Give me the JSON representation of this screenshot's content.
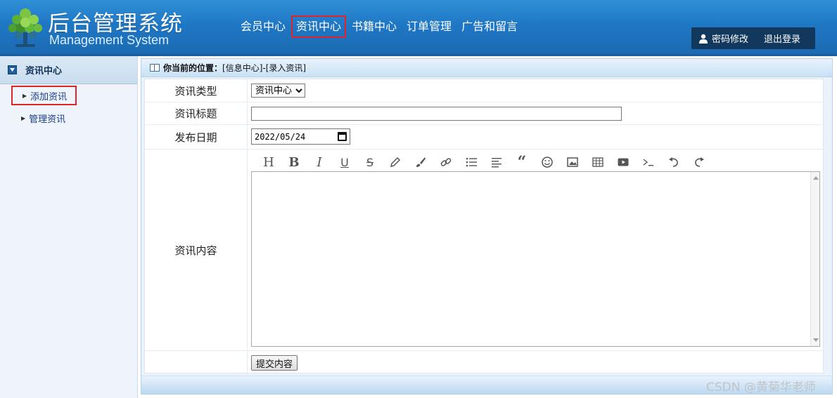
{
  "header": {
    "title": "后台管理系统",
    "subtitle": "Management System",
    "nav": [
      {
        "label": "会员中心",
        "active": false
      },
      {
        "label": "资讯中心",
        "active": true
      },
      {
        "label": "书籍中心",
        "active": false
      },
      {
        "label": "订单管理",
        "active": false
      },
      {
        "label": "广告和留言",
        "active": false
      }
    ],
    "user_links": {
      "change_password": "密码修改",
      "logout": "退出登录"
    }
  },
  "sidebar": {
    "section_title": "资讯中心",
    "items": [
      {
        "label": "添加资讯",
        "active": true
      },
      {
        "label": "管理资讯",
        "active": false
      }
    ]
  },
  "breadcrumb": {
    "prefix": "你当前的位置：",
    "path": "[信息中心]-[录入资讯]"
  },
  "form": {
    "type_label": "资讯类型",
    "type_selected": "资讯中心",
    "title_label": "资讯标题",
    "title_value": "",
    "date_label": "发布日期",
    "date_value": "2022/05/24",
    "content_label": "资讯内容",
    "content_value": "",
    "toolbar_icons": [
      "heading-icon",
      "bold-icon",
      "italic-icon",
      "underline-icon",
      "strikethrough-icon",
      "pencil-icon",
      "brush-icon",
      "link-icon",
      "list-icon",
      "align-left-icon",
      "quote-icon",
      "emoji-icon",
      "image-icon",
      "table-icon",
      "video-icon",
      "code-icon",
      "undo-icon",
      "redo-icon"
    ],
    "submit_label": "提交内容"
  },
  "watermark": "CSDN @黄菊华老师",
  "colors": {
    "header_blue": "#1f77c4",
    "highlight_red": "#e0242a",
    "user_box": "#12385e",
    "link_blue": "#1a3d8a"
  }
}
